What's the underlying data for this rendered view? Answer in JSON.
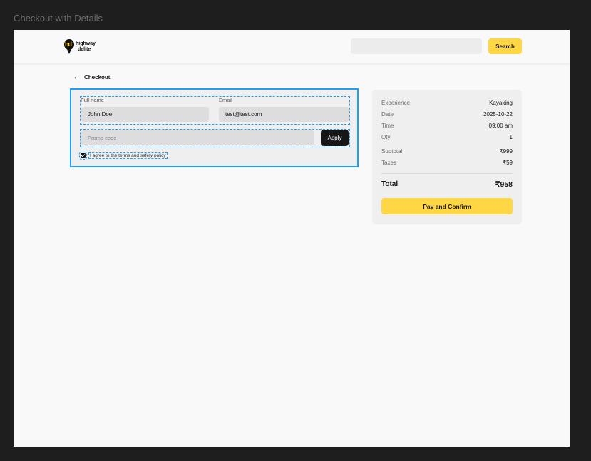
{
  "frame_title": "Checkout with Details",
  "header": {
    "logo": {
      "mark": "hd",
      "line1": "highway",
      "line2": "delite"
    },
    "search": {
      "placeholder": "",
      "value": ""
    },
    "search_button": "Search"
  },
  "back": {
    "label": "Checkout",
    "icon": "arrow-left-icon"
  },
  "form": {
    "full_name": {
      "label": "Full name",
      "value": "John Doe"
    },
    "email": {
      "label": "Email",
      "value": "test@test.com"
    },
    "promo": {
      "placeholder": "Promo code"
    },
    "apply_button": "Apply",
    "terms": {
      "checked": true,
      "label": "I agree to the terms and safety policy"
    }
  },
  "summary": {
    "rows": [
      {
        "label": "Experience",
        "value": "Kayaking"
      },
      {
        "label": "Date",
        "value": "2025-10-22"
      },
      {
        "label": "Time",
        "value": "09:00 am"
      },
      {
        "label": "Qty",
        "value": "1"
      },
      {
        "label": "Subtotal",
        "value": "₹999"
      },
      {
        "label": "Taxes",
        "value": "₹59"
      }
    ],
    "total": {
      "label": "Total",
      "value": "₹958"
    },
    "pay_button": "Pay and Confirm"
  },
  "colors": {
    "accent": "#ffd643",
    "selection": "#1a9fff",
    "dark": "#161616",
    "background": "#f9f9f9"
  }
}
